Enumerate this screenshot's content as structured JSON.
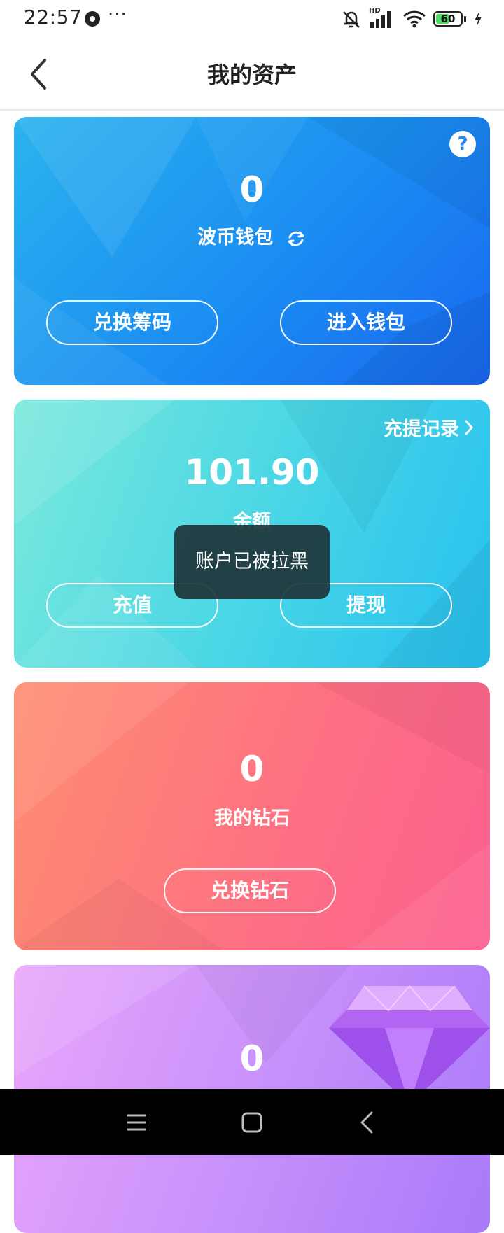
{
  "status_bar": {
    "time": "22:57",
    "more": "···",
    "network": "HD",
    "battery": "60",
    "battery_level": 0.6
  },
  "nav": {
    "title": "我的资产"
  },
  "wallet_card": {
    "value": "0",
    "label": "波币钱包",
    "help": "?",
    "buttons": [
      "兑换筹码",
      "进入钱包"
    ]
  },
  "balance_card": {
    "record_link": "充提记录",
    "value": "101.90",
    "label": "余额",
    "buttons": [
      "充值",
      "提现"
    ]
  },
  "diamond_card": {
    "value": "0",
    "label": "我的钻石",
    "button": "兑换钻石"
  },
  "fourth_card": {
    "value": "0"
  },
  "toast": {
    "message": "账户已被拉黑"
  },
  "colors": {
    "wallet": "#1a8df2",
    "balance": "#47d5e6",
    "diamond": "#fd6f84",
    "gem": "#c991fb"
  }
}
